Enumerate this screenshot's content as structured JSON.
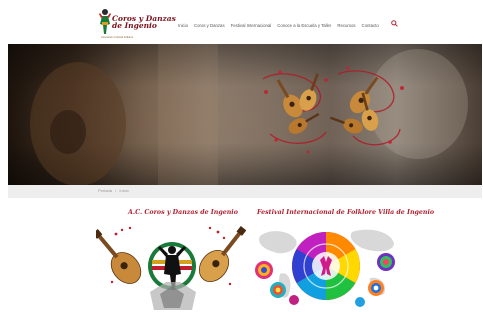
{
  "site": {
    "logo_title_line1": "Coros y Danzas",
    "logo_title_line2": "de Ingenio",
    "logo_subtitle": "Asociación Cultural Folklore"
  },
  "nav": {
    "items": [
      {
        "label": "Inicio"
      },
      {
        "label": "Coros y Danzas"
      },
      {
        "label": "Festival Internacional"
      },
      {
        "label": "Conoce a la Escuela y Taller"
      },
      {
        "label": "Recursos"
      },
      {
        "label": "Contacto"
      }
    ],
    "search_icon": "search-icon"
  },
  "breadcrumb": {
    "home": "Portada",
    "separator": "/",
    "current": "Inicio"
  },
  "cards": [
    {
      "title": "A.C. Coros y Danzas de Ingenio",
      "image": "dancers-timples-illustration"
    },
    {
      "title": "Festival Internacional de Folklore Villa de Ingenio",
      "image": "festival-colorful-mandala-poster"
    }
  ],
  "colors": {
    "brand": "#7a1018",
    "accent": "#b02030",
    "nav_text": "#555555",
    "breadcrumb_bg": "#eeeeee"
  }
}
